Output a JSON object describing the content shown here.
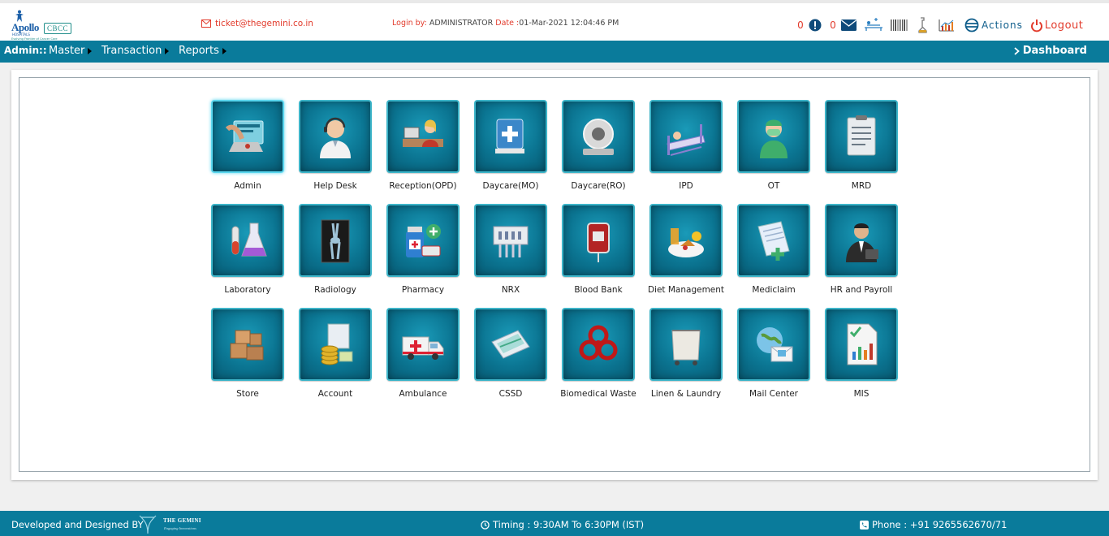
{
  "header": {
    "logo": {
      "brand": "Apollo",
      "sub": "HOSPITALS",
      "unit": "CBCC",
      "tagline": "Evolving Frontier of Cancer Care"
    },
    "ticket_email": "ticket@thegemini.co.in",
    "login_label": "Login by:",
    "login_user": "ADMINISTRATOR",
    "date_label": "Date :",
    "date_value": "01-Mar-2021  12:04:46 PM",
    "alert_count": "0",
    "mail_count": "0",
    "actions_label": "Actions",
    "logout_label": "Logout"
  },
  "nav": {
    "admin_label": "Admin::",
    "menus": [
      "Master",
      "Transaction",
      "Reports"
    ],
    "dashboard_label": "Dashboard"
  },
  "modules": [
    {
      "label": "Admin",
      "icon": "admin-icon"
    },
    {
      "label": "Help Desk",
      "icon": "help-desk-icon"
    },
    {
      "label": "Reception(OPD)",
      "icon": "reception-icon"
    },
    {
      "label": "Daycare(MO)",
      "icon": "daycare-mo-icon"
    },
    {
      "label": "Daycare(RO)",
      "icon": "daycare-ro-icon"
    },
    {
      "label": "IPD",
      "icon": "ipd-bed-icon"
    },
    {
      "label": "OT",
      "icon": "surgeon-icon"
    },
    {
      "label": "MRD",
      "icon": "clipboard-icon"
    },
    {
      "label": "Laboratory",
      "icon": "flask-icon"
    },
    {
      "label": "Radiology",
      "icon": "xray-icon"
    },
    {
      "label": "Pharmacy",
      "icon": "medicine-bottle-icon"
    },
    {
      "label": "NRX",
      "icon": "test-strip-icon"
    },
    {
      "label": "Blood Bank",
      "icon": "blood-bag-icon"
    },
    {
      "label": "Diet Management",
      "icon": "food-plate-icon"
    },
    {
      "label": "Mediclaim",
      "icon": "claim-form-icon"
    },
    {
      "label": "HR and Payroll",
      "icon": "businessman-icon"
    },
    {
      "label": "Store",
      "icon": "boxes-icon"
    },
    {
      "label": "Account",
      "icon": "coins-icon"
    },
    {
      "label": "Ambulance",
      "icon": "ambulance-icon"
    },
    {
      "label": "CSSD",
      "icon": "sterile-pack-icon"
    },
    {
      "label": "Biomedical Waste",
      "icon": "biohazard-icon"
    },
    {
      "label": "Linen & Laundry",
      "icon": "laundry-cart-icon"
    },
    {
      "label": "Mail Center",
      "icon": "mail-globe-icon"
    },
    {
      "label": "MIS",
      "icon": "report-icon"
    }
  ],
  "colors": {
    "primary": "#0a7b9b",
    "accent": "#e23b2c",
    "tile_border": "#3db5c9"
  },
  "footer": {
    "developed_by": "Developed and Designed BY",
    "gemini_name": "THE GEMINI",
    "gemini_tag": "Engaging Innovations",
    "timing": "Timing : 9:30AM To 6:30PM (IST)",
    "phone": "Phone : +91 9265562670/71"
  }
}
